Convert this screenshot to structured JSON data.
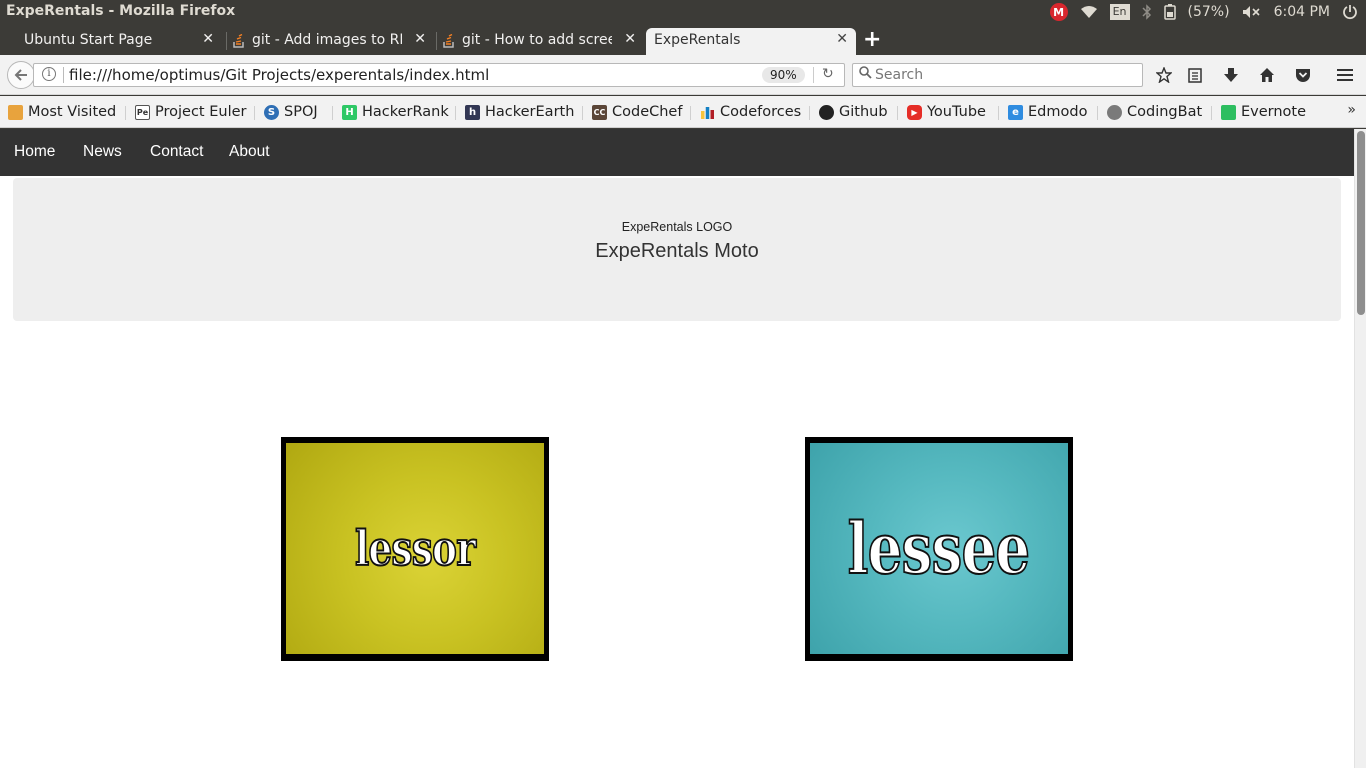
{
  "window": {
    "title": "ExpeRentals - Mozilla Firefox"
  },
  "system_tray": {
    "mega_letter": "M",
    "keyboard_layout": "En",
    "battery": "(57%)",
    "time": "6:04 PM"
  },
  "tabs": [
    {
      "label": "Ubuntu Start Page",
      "active": false
    },
    {
      "label": "git - Add images to REA",
      "active": false
    },
    {
      "label": "git - How to add screen",
      "active": false
    },
    {
      "label": "ExpeRentals",
      "active": true
    }
  ],
  "toolbar": {
    "url": "file:///home/optimus/Git Projects/experentals/index.html",
    "zoom": "90%",
    "search_placeholder": "Search"
  },
  "bookmarks": [
    {
      "label": "Most Visited",
      "icon": "folder-icon"
    },
    {
      "label": "Project Euler",
      "icon": "project-euler-icon"
    },
    {
      "label": "SPOJ",
      "icon": "spoj-icon"
    },
    {
      "label": "HackerRank",
      "icon": "hackerrank-icon"
    },
    {
      "label": "HackerEarth",
      "icon": "hackerearth-icon"
    },
    {
      "label": "CodeChef",
      "icon": "codechef-icon"
    },
    {
      "label": "Codeforces",
      "icon": "codeforces-icon"
    },
    {
      "label": "Github",
      "icon": "github-icon"
    },
    {
      "label": "YouTube",
      "icon": "youtube-icon"
    },
    {
      "label": "Edmodo",
      "icon": "edmodo-icon"
    },
    {
      "label": "CodingBat",
      "icon": "codingbat-icon"
    },
    {
      "label": "Evernote",
      "icon": "evernote-icon"
    }
  ],
  "site": {
    "nav": [
      "Home",
      "News",
      "Contact",
      "About"
    ],
    "logo_text": "ExpeRentals LOGO",
    "moto": "ExpeRentals Moto",
    "cards": [
      {
        "word": "lessor",
        "color": "#cdc521"
      },
      {
        "word": "lessee",
        "color": "#55b8bf"
      }
    ]
  },
  "colors": {
    "titlebar": "#3c3b37",
    "site_nav": "#333333",
    "jumbotron": "#eeeeee"
  }
}
